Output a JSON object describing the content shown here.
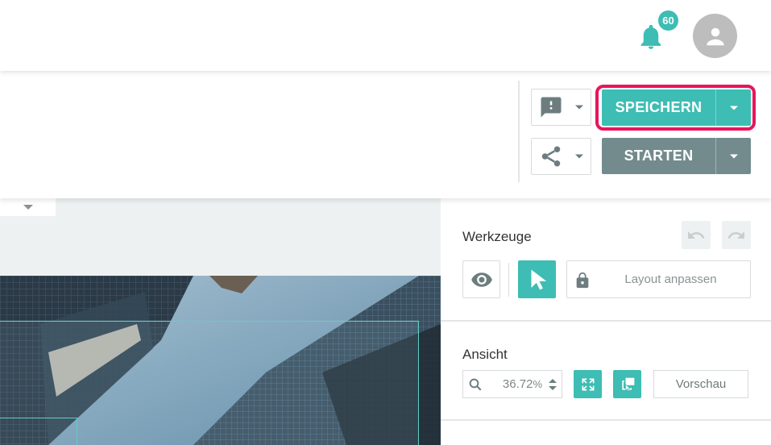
{
  "header": {
    "notification_count": "60",
    "accent_color": "#3dbdb4"
  },
  "actions": {
    "feedback_icon": "feedback-icon",
    "share_icon": "share-icon",
    "save_label": "SPEICHERN",
    "start_label": "STARTEN",
    "highlight_color": "#e8155c"
  },
  "tools": {
    "title": "Werkzeuge",
    "layout_label": "Layout anpassen"
  },
  "view": {
    "title": "Ansicht",
    "zoom_value": "36.72",
    "zoom_unit": "%",
    "preview_label": "Vorschau"
  }
}
